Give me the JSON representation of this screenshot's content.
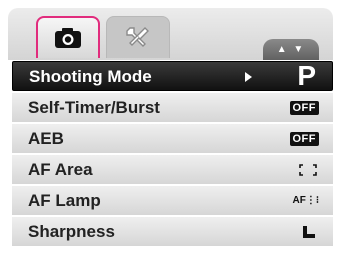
{
  "tabs": [
    {
      "name": "camera",
      "icon": "camera-icon",
      "active": true
    },
    {
      "name": "setup",
      "icon": "tools-icon",
      "active": false
    }
  ],
  "scroll_indicator": "▲ ▼",
  "menu": {
    "items": [
      {
        "label": "Shooting Mode",
        "value": "P",
        "selected": true
      },
      {
        "label": "Self-Timer/Burst",
        "value": "OFF"
      },
      {
        "label": "AEB",
        "value": "OFF"
      },
      {
        "label": "AF Area",
        "value_icon": "af-area-icon"
      },
      {
        "label": "AF Lamp",
        "value": "AF",
        "value_icon": "af-lamp-icon"
      },
      {
        "label": "Sharpness",
        "value_icon": "sharpness-icon"
      }
    ]
  },
  "colors": {
    "selected_row": "#1a1a1a",
    "row_bg": "#e3e3e3",
    "active_tab_border": "#e12c7d"
  }
}
